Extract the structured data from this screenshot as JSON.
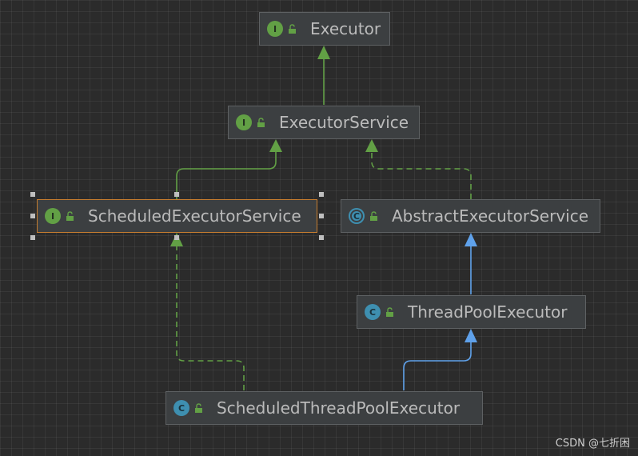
{
  "nodes": {
    "executor": {
      "name": "Executor",
      "kind": "interface",
      "badge": "I"
    },
    "executor_service": {
      "name": "ExecutorService",
      "kind": "interface",
      "badge": "I"
    },
    "scheduled_executor_service": {
      "name": "ScheduledExecutorService",
      "kind": "interface",
      "badge": "I",
      "selected": true
    },
    "abstract_executor_service": {
      "name": "AbstractExecutorService",
      "kind": "abstract class",
      "badge": "C"
    },
    "thread_pool_executor": {
      "name": "ThreadPoolExecutor",
      "kind": "class",
      "badge": "C"
    },
    "scheduled_thread_pool_executor": {
      "name": "ScheduledThreadPoolExecutor",
      "kind": "class",
      "badge": "C"
    }
  },
  "edges": [
    {
      "from": "executor_service",
      "to": "executor",
      "type": "extends-interface"
    },
    {
      "from": "scheduled_executor_service",
      "to": "executor_service",
      "type": "extends-interface"
    },
    {
      "from": "abstract_executor_service",
      "to": "executor_service",
      "type": "implements"
    },
    {
      "from": "thread_pool_executor",
      "to": "abstract_executor_service",
      "type": "extends-class"
    },
    {
      "from": "scheduled_thread_pool_executor",
      "to": "thread_pool_executor",
      "type": "extends-class"
    },
    {
      "from": "scheduled_thread_pool_executor",
      "to": "scheduled_executor_service",
      "type": "implements"
    }
  ],
  "colors": {
    "interface_edge": "#62a045",
    "class_edge": "#5fa1ea",
    "node_bg": "#3c3f41",
    "selection": "#c67d2f"
  },
  "icons": {
    "access": "lock-open-icon"
  },
  "watermark": "CSDN @七折困"
}
